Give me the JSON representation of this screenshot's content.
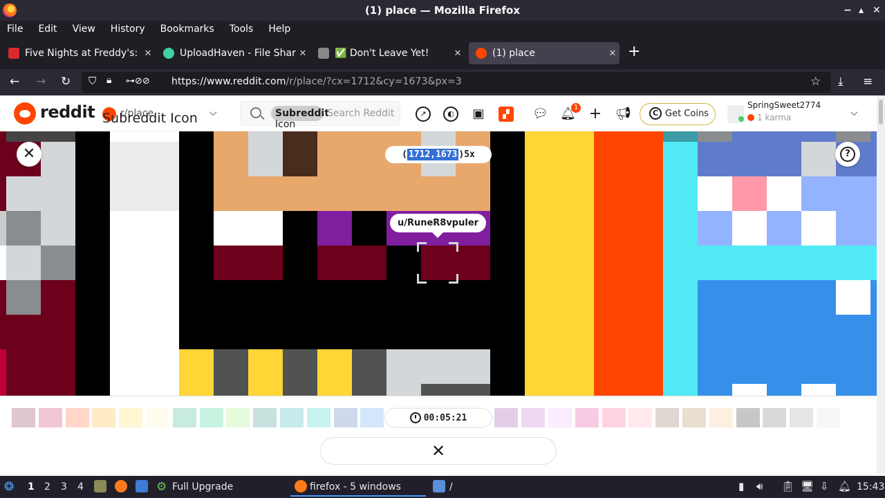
{
  "window": {
    "title": "(1) place — Mozilla Firefox",
    "controls": [
      "−",
      "▴",
      "✕"
    ]
  },
  "menu": [
    "File",
    "Edit",
    "View",
    "History",
    "Bookmarks",
    "Tools",
    "Help"
  ],
  "tabs": [
    {
      "label": "Five Nights at Freddy's: S",
      "icon_color": "#d92b2b",
      "active": false
    },
    {
      "label": "UploadHaven - File Sharin",
      "icon_color": "#3fd1a2",
      "active": false
    },
    {
      "label": "✅ Don't Leave Yet!",
      "icon_color": "#888888",
      "active": false
    },
    {
      "label": "(1) place",
      "icon_color": "#ff4500",
      "active": true
    }
  ],
  "nav": {
    "url_host": "https://www.reddit.com",
    "url_path": "/r/place/?cx=1712&cy=1673&px=3"
  },
  "reddit_header": {
    "wordmark": "reddit",
    "subreddit": "r/place",
    "subreddit_icon_alt": "Subreddit Icon",
    "search_chip": "Subreddit",
    "search_chip_alt": "Icon",
    "search_placeholder": "Search Reddit",
    "notification_count": "1",
    "get_coins": "Get Coins",
    "coin_glyph": "C",
    "username": "SpringSweet2774",
    "karma": "1 karma"
  },
  "canvas": {
    "coordinates_highlight": "1712,1673",
    "coordinates_rest": " 5x",
    "coordinates_open": "(",
    "coordinates_close": ")",
    "pixel_author": "u/RuneR8vpuler",
    "help_glyph": "?",
    "close_glyph": "✕"
  },
  "palette": {
    "timer": "00:05:21",
    "cancel_glyph": "✕",
    "colors": [
      "#6d001a",
      "#be0039",
      "#ff4500",
      "#ffa800",
      "#ffd635",
      "#fff8b8",
      "#00a368",
      "#00cc78",
      "#7eed56",
      "#00756f",
      "#009eaa",
      "#00ccc0",
      "#2450a4",
      "#3690ea",
      "#51e9f4",
      "#493ac1",
      "#6a5cff",
      "#94b3ff",
      "#811e9f",
      "#b44ac0",
      "#e4abff",
      "#de107f",
      "#ff3881",
      "#ff99aa",
      "#6d482f",
      "#9c6926",
      "#ffb470",
      "#000000",
      "#515252",
      "#898d90",
      "#d4d7d9",
      "#ffffff"
    ]
  },
  "taskbar": {
    "workspaces": [
      "1",
      "2",
      "3",
      "4"
    ],
    "upgrade": "Full Upgrade",
    "firefox": "firefox - 5 windows",
    "folder": "/",
    "clock": "15:43"
  }
}
